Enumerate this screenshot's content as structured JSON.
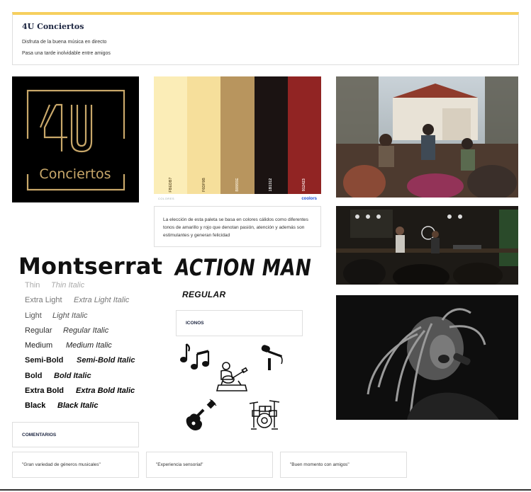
{
  "header": {
    "title": "4U Conciertos",
    "line1": "Disfruta de la buena música en directo",
    "line2": "Pasa una tarde inolvidable entre amigos"
  },
  "logo": {
    "big": "4U",
    "word": "Conciertos",
    "color": "#c9a86a"
  },
  "palette": {
    "swatches": [
      {
        "hex": "FBEDB7",
        "color": "#fbedb7"
      },
      {
        "hex": "F6DF9B",
        "color": "#f6df9b"
      },
      {
        "hex": "B8955E",
        "color": "#b8955e"
      },
      {
        "hex": "1B1312",
        "color": "#1b1312"
      },
      {
        "hex": "912423",
        "color": "#912423"
      }
    ],
    "footer_small": "COLORES",
    "brand": "coolors",
    "description": "La elección de esta paleta se basa en colores cálidos como diferentes tonos de amarillo y rojo que denotan pasión, atención y además son estimulantes y generan felicidad"
  },
  "typography": {
    "font1": "Montserrat",
    "weights": [
      {
        "name": "Thin",
        "italic": "Thin Italic",
        "weight": 100,
        "color": "#aaaaaa"
      },
      {
        "name": "Extra Light",
        "italic": "Extra Light Italic",
        "weight": 200,
        "color": "#777777"
      },
      {
        "name": "Light",
        "italic": "Light Italic",
        "weight": 300,
        "color": "#555555"
      },
      {
        "name": "Regular",
        "italic": "Regular Italic",
        "weight": 400,
        "color": "#333333"
      },
      {
        "name": "Medium",
        "italic": "Medium Italic",
        "weight": 500,
        "color": "#222222"
      },
      {
        "name": "Semi-Bold",
        "italic": "Semi-Bold Italic",
        "weight": 600,
        "color": "#111111"
      },
      {
        "name": "Bold",
        "italic": "Bold Italic",
        "weight": 700,
        "color": "#111111"
      },
      {
        "name": "Extra Bold",
        "italic": "Extra Bold Italic",
        "weight": 800,
        "color": "#000000"
      },
      {
        "name": "Black",
        "italic": "Black Italic",
        "weight": 900,
        "color": "#000000"
      }
    ],
    "font2": "ACTION MAN",
    "font2_style": "REGULAR"
  },
  "icons": {
    "label": "ICONOS",
    "items": [
      "music-notes-icon",
      "microphone-icon",
      "guitarist-icon",
      "electric-guitar-icon",
      "drum-kit-icon"
    ]
  },
  "comments": {
    "label": "COMENTARIOS",
    "quotes": [
      "\"Gran variedad de géneros musicales\"",
      "\"Experiencia sensorial\"",
      "\"Buen momento con amigos\""
    ]
  },
  "photos": [
    "acoustic-concert-photo",
    "live-band-photo",
    "singer-bw-photo"
  ]
}
